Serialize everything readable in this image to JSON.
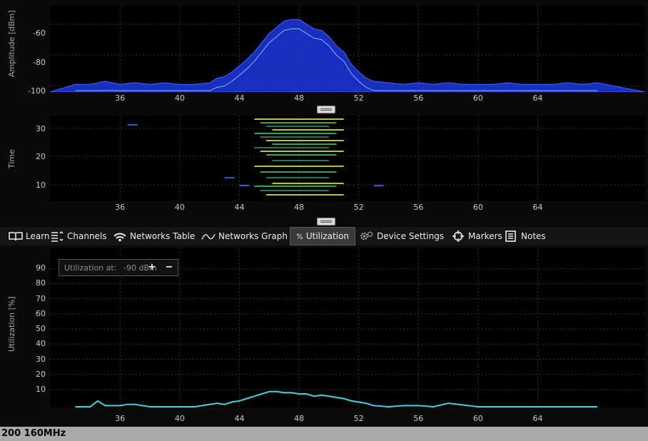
{
  "spectrum": {
    "ylabel": "Amplitude [dBm]",
    "yticks": [
      "-60",
      "-80",
      "-100"
    ],
    "xticks": [
      "36",
      "40",
      "44",
      "48",
      "52",
      "56",
      "60",
      "64"
    ]
  },
  "waterfall": {
    "ylabel": "Time",
    "yticks": [
      "30",
      "20",
      "10"
    ],
    "xticks": [
      "36",
      "40",
      "44",
      "48",
      "52",
      "56",
      "60",
      "64"
    ]
  },
  "tabs": [
    {
      "label": "Learn",
      "icon": "book-icon"
    },
    {
      "label": "Channels",
      "icon": "channels-icon"
    },
    {
      "label": "Networks Table",
      "icon": "wifi-icon"
    },
    {
      "label": "Networks Graph",
      "icon": "graph-wave-icon"
    },
    {
      "label": "Utilization",
      "icon": "percent-icon",
      "active": true
    },
    {
      "label": "Device Settings",
      "icon": "gears-icon"
    },
    {
      "label": "Markers",
      "icon": "crosshair-icon"
    },
    {
      "label": "Notes",
      "icon": "notes-icon"
    }
  ],
  "utilization": {
    "ylabel": "Utilization [%]",
    "yticks": [
      "90",
      "80",
      "70",
      "60",
      "50",
      "40",
      "30",
      "20",
      "10"
    ],
    "xticks": [
      "36",
      "40",
      "44",
      "48",
      "52",
      "56",
      "60",
      "64"
    ],
    "control": {
      "label": "Utilization at:",
      "value": "-90",
      "unit": "dBm",
      "plus": "+",
      "minus": "−"
    }
  },
  "status": {
    "text": "200 160MHz"
  },
  "colors": {
    "trace": "#33d6e6",
    "spectrum": "#1f3dff",
    "grid": "#3a3a3a"
  },
  "chart_data": [
    {
      "type": "area",
      "name": "spectrum",
      "xlabel": "",
      "ylabel": "Amplitude [dBm]",
      "ylim": [
        -104,
        -48
      ],
      "x": [
        33,
        34,
        35,
        36,
        37,
        38,
        39,
        40,
        41,
        42,
        42.5,
        43,
        43.5,
        44,
        44.5,
        45,
        45.5,
        46,
        46.5,
        47,
        47.5,
        48,
        48.5,
        49,
        49.5,
        50,
        50.5,
        51,
        51.5,
        52,
        52.5,
        53,
        54,
        55,
        56,
        57,
        58,
        59,
        60,
        61,
        62,
        63,
        64,
        65,
        66,
        67,
        68
      ],
      "y": [
        -99,
        -99,
        -97,
        -99,
        -98,
        -99,
        -98,
        -99,
        -99,
        -98,
        -95,
        -94,
        -91,
        -87,
        -83,
        -78,
        -72,
        -66,
        -62,
        -58,
        -57,
        -57,
        -60,
        -63,
        -64,
        -68,
        -74,
        -78,
        -86,
        -91,
        -95,
        -97,
        -98,
        -99,
        -98,
        -99,
        -98,
        -99,
        -99,
        -99,
        -98,
        -99,
        -99,
        -99,
        -98,
        -99,
        -98
      ]
    },
    {
      "type": "line",
      "name": "utilization",
      "xlabel": "",
      "ylabel": "Utilization [%]",
      "ylim": [
        0,
        100
      ],
      "x": [
        33,
        34,
        34.5,
        35,
        36,
        36.5,
        37,
        38,
        41,
        42,
        42.5,
        43,
        43.5,
        44,
        44.5,
        45,
        45.5,
        46,
        46.5,
        47,
        47.5,
        48,
        48.5,
        49,
        49.5,
        50,
        50.5,
        51,
        51.5,
        52,
        52.5,
        53,
        54,
        55,
        56,
        57,
        58,
        60,
        64,
        68
      ],
      "y": [
        0,
        0,
        5,
        1,
        1,
        2,
        2,
        0,
        0,
        2,
        3,
        2,
        4,
        5,
        7,
        9,
        11,
        13,
        13,
        12,
        12,
        11,
        11,
        9,
        10,
        9,
        8,
        7,
        5,
        4,
        3,
        1,
        0,
        1,
        1,
        0,
        3,
        0,
        0,
        0
      ]
    }
  ]
}
